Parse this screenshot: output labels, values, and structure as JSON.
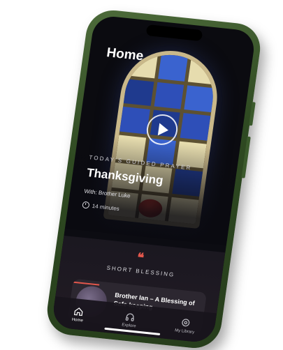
{
  "header": {
    "title": "Home"
  },
  "featured": {
    "kicker": "TODAY'S GUIDED PRAYER",
    "title": "Thanksgiving",
    "with": "With: Brother Luke",
    "duration": "14 minutes"
  },
  "blessing": {
    "section_label": "SHORT BLESSING",
    "card_title": "Brother Ian – A Blessing of Safe-keeping"
  },
  "tabbar": {
    "items": [
      {
        "label": "Home",
        "icon": "home-icon"
      },
      {
        "label": "Explore",
        "icon": "headphones-icon"
      },
      {
        "label": "My Library",
        "icon": "library-icon"
      }
    ]
  },
  "colors": {
    "phone_body": "#2f4a22",
    "accent": "#e2574c",
    "glass_blue": "#2e4fb8",
    "glass_cream": "#e6dcae"
  }
}
